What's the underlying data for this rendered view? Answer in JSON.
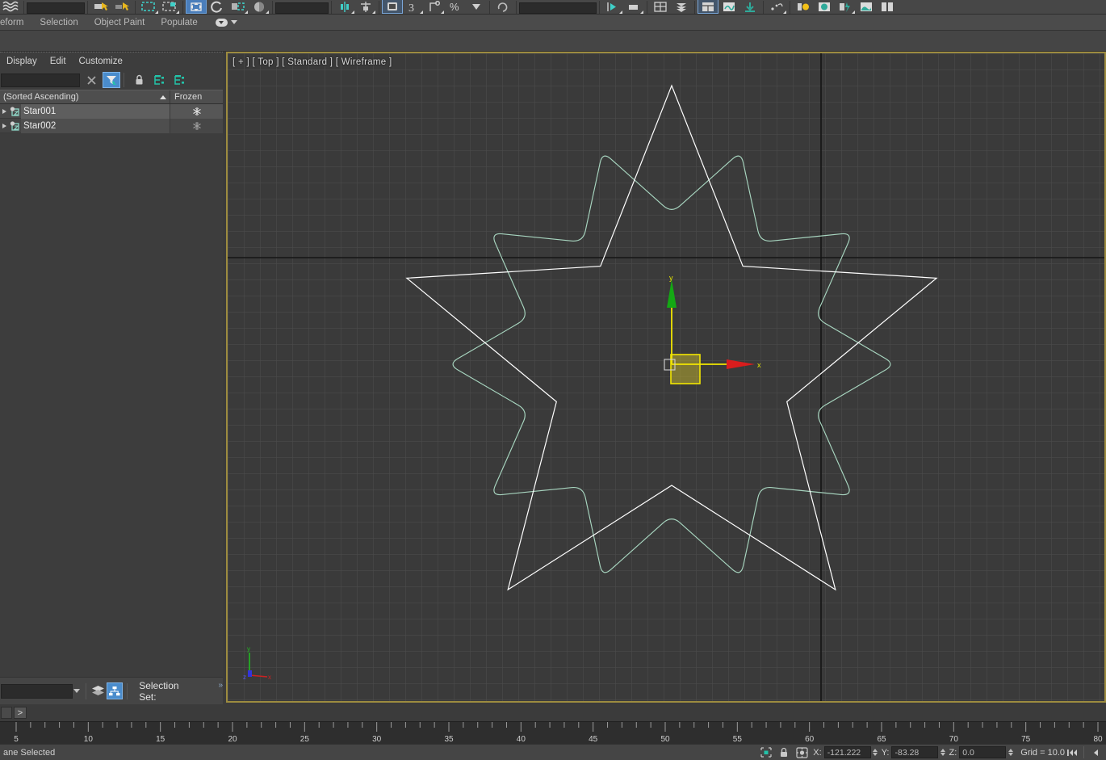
{
  "app": {
    "name": "3ds Max",
    "accent_blue": "#4a8ccc",
    "viewport_border": "#9c8b3f",
    "viewport_bg": "#3a3a3a",
    "panel_bg": "#3d3d3d"
  },
  "ribbon": {
    "tabs": [
      {
        "label": "eform"
      },
      {
        "label": "Selection"
      },
      {
        "label": "Object Paint"
      },
      {
        "label": "Populate"
      }
    ],
    "populate_dropdown_icon": "populate-pill-icon",
    "icons": [
      "wave-modifier-icon",
      "text-field",
      "paint-select-icon",
      "paint-deform-icon",
      "soft-selection-icon",
      "polygon-select-icon",
      "move-gizmo-icon",
      "rotate-icon",
      "scale-icon",
      "shade-icon",
      "value-field",
      "symmetry-icon",
      "relax-icon",
      "freeze-icon",
      "shift-icon",
      "pinch-icon",
      "percent-icon"
    ]
  },
  "explorer": {
    "menus": [
      {
        "label": "Display"
      },
      {
        "label": "Edit"
      },
      {
        "label": "Customize"
      }
    ],
    "search_placeholder": "",
    "search_value": "",
    "toolbar": [
      {
        "name": "clear-search-icon",
        "active": false
      },
      {
        "name": "filter-icon",
        "active": true
      },
      {
        "name": "lock-icon",
        "active": false
      },
      {
        "name": "expand-all-icon",
        "active": false
      },
      {
        "name": "collapse-all-icon",
        "active": false
      }
    ],
    "columns": {
      "name": "(Sorted Ascending)",
      "frozen": "Frozen"
    },
    "rows": [
      {
        "name": "Star001",
        "icon": "shape-object-icon",
        "frozen": true,
        "selected": true
      },
      {
        "name": "Star002",
        "icon": "shape-object-icon",
        "frozen": true,
        "selected": false
      }
    ]
  },
  "left_bottom": {
    "combo_value": "",
    "layers_icon": "layers-icon",
    "hierarchy_icon": "scene-hierarchy-icon",
    "selection_set_label": "Selection Set:",
    "overflow_label": "»"
  },
  "listener": {
    "prompt_label": ">"
  },
  "viewport": {
    "label": "[ + ] [ Top ] [ Standard ] [ Wireframe ]",
    "label_parts": [
      "[+]",
      "[Top]",
      "[Standard]",
      "[Wireframe]"
    ],
    "grid_spacing_px": 20,
    "grid_color": "#4d4d4d",
    "axis_color": "#141414",
    "gizmo": {
      "x_axis_label": "x",
      "y_axis_label": "y",
      "x_arrow_color": "#d91d1d",
      "y_arrow_color": "#14a814",
      "axis_line_color": "#f2e600",
      "plane_fill": "#c4b62b"
    },
    "tripod": {
      "x_label": "x",
      "y_label": "y",
      "z_label": "z",
      "x_color": "#cc2222",
      "y_color": "#22bb22",
      "z_color": "#3333dd"
    },
    "objects": [
      {
        "name": "Star001",
        "color": "#ffffff",
        "points": 5,
        "kind": "star-spline-sharp"
      },
      {
        "name": "Star002",
        "color": "#a8d6c0",
        "points": 10,
        "kind": "star-spline-filleted"
      }
    ]
  },
  "timeline": {
    "ticks": [
      5,
      10,
      15,
      20,
      25,
      30,
      35,
      40,
      45,
      50,
      55,
      60,
      65,
      70,
      75,
      80
    ],
    "start": 5,
    "end": 80,
    "minor_per_major": 5
  },
  "statusbar": {
    "status_text": "ane Selected",
    "icons": [
      "selection-lock-icon",
      "padlock-icon",
      "absolute-mode-icon"
    ],
    "coords": [
      {
        "label": "X:",
        "value": "-121.222"
      },
      {
        "label": "Y:",
        "value": "-83.28"
      },
      {
        "label": "Z:",
        "value": "0.0"
      }
    ],
    "grid_label": "Grid = 10.0",
    "playback": [
      "go-to-start-icon",
      "previous-frame-icon"
    ]
  }
}
